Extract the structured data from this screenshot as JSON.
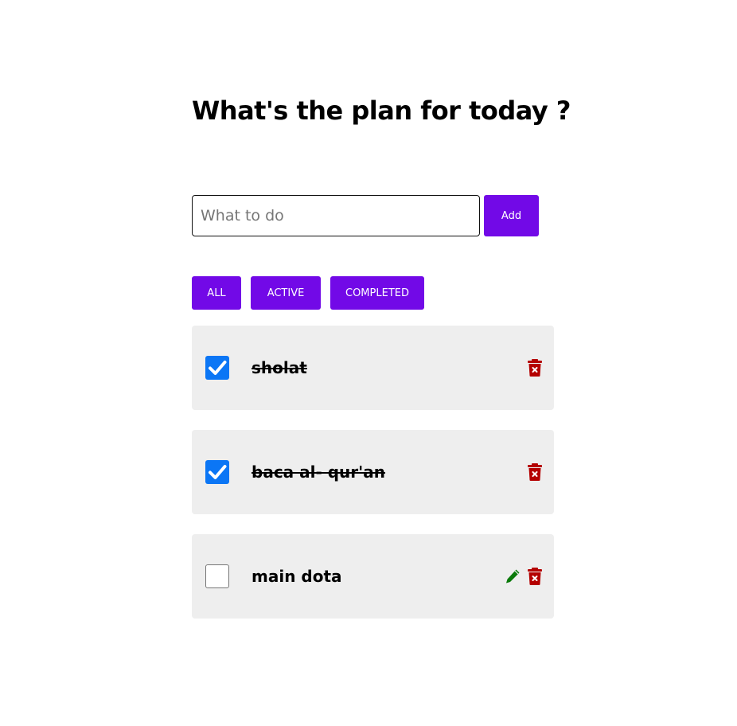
{
  "header": {
    "title": "What's the plan for today ?"
  },
  "add_form": {
    "placeholder": "What to do",
    "value": "",
    "add_label": "Add"
  },
  "filters": {
    "all_label": "ALL",
    "active_label": "ACTIVE",
    "completed_label": "COMPLETED"
  },
  "todos": [
    {
      "text": "sholat",
      "completed": true,
      "icons": [
        "trash-icon"
      ]
    },
    {
      "text": "baca al- qur'an",
      "completed": true,
      "icons": [
        "trash-icon"
      ]
    },
    {
      "text": "main dota",
      "completed": false,
      "icons": [
        "pencil-icon",
        "trash-icon"
      ]
    }
  ],
  "colors": {
    "accent": "#7209e7",
    "checkbox": "#0b76f5",
    "delete": "#b40000",
    "edit": "#0a7a0a",
    "item_background": "#eeeeee"
  }
}
